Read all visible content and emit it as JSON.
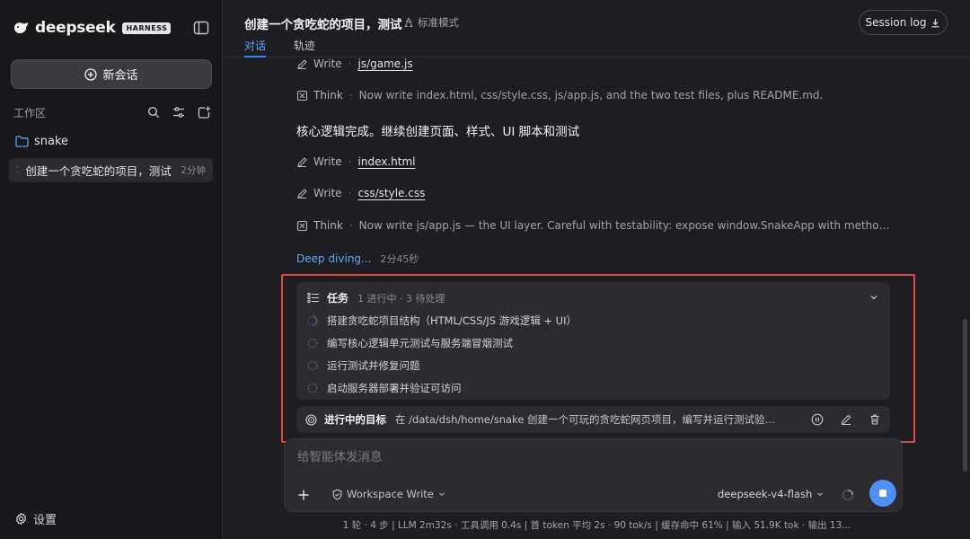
{
  "sidebar": {
    "logo": "deepseek",
    "badge": "HARNESS",
    "new_chat_label": "新会话",
    "workspace_label": "工作区",
    "folder_name": "snake",
    "session": {
      "title": "创建一个贪吃蛇的项目，测试",
      "time": "2分钟"
    },
    "settings_label": "设置"
  },
  "header": {
    "title": "创建一个贪吃蛇的项目，测试",
    "mode": "标准模式",
    "tabs": [
      "对话",
      "轨迹"
    ],
    "session_log_label": "Session log"
  },
  "conversation": {
    "write_label": "Write",
    "think_label": "Think",
    "line1_file": "js/game.js",
    "line2_text": "Now write index.html, css/style.css, js/app.js, and the two test files, plus README.md.",
    "heading": "核心逻辑完成。继续创建页面、样式、UI 脚本和测试",
    "line3_file": "index.html",
    "line4_file": "css/style.css",
    "line5_text": "Now write js/app.js — the UI layer. Careful with testability: expose window.SnakeApp with methods; gu...",
    "deep_label": "Deep diving...",
    "deep_time": "2分45秒"
  },
  "tasks": {
    "title": "任务",
    "meta": "1 进行中 · 3 待处理",
    "items": [
      "搭建贪吃蛇项目结构（HTML/CSS/JS 游戏逻辑 + UI）",
      "编写核心逻辑单元测试与服务端冒烟测试",
      "运行测试并修复问题",
      "启动服务器部署并验证可访问"
    ]
  },
  "goal": {
    "label": "进行中的目标",
    "text": "在 /data/dsh/home/snake 创建一个可玩的贪吃蛇网页项目，编写并运行测试验证游戏..."
  },
  "composer": {
    "placeholder": "给智能体发消息",
    "workspace_write": "Workspace Write",
    "model": "deepseek-v4-flash"
  },
  "status": "1 轮 · 4 步 | LLM 2m32s · 工具调用 0.4s | 首 token 平均 2s · 90 tok/s | 缓存命中 61% | 输入 51.9K tok · 输出 13...",
  "colors": {
    "accent": "#4f8ff7",
    "highlight": "#e0474c",
    "link": "#60a5fa"
  }
}
